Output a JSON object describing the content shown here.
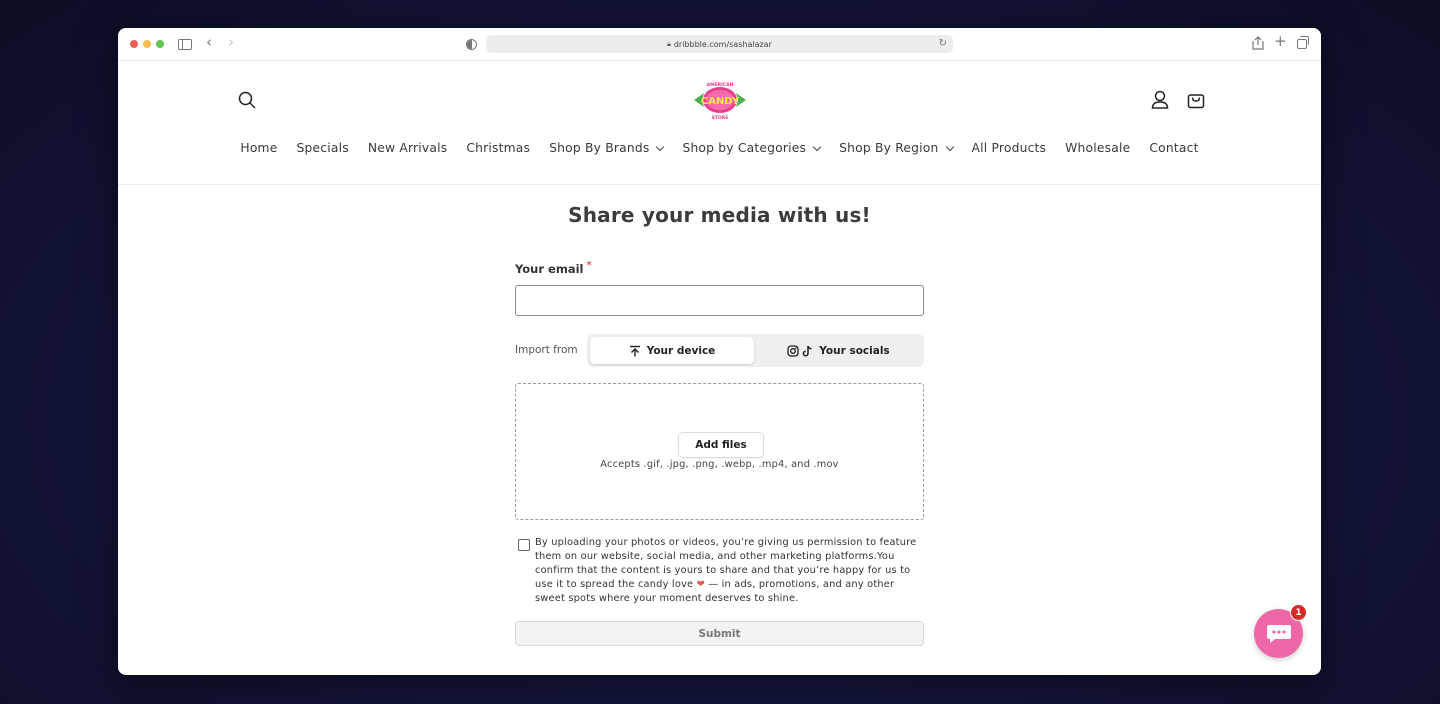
{
  "browser": {
    "url": "dribbble.com/sashalazar"
  },
  "header": {
    "logo_lines": [
      "AMERICAN",
      "CANDY",
      "STORE"
    ],
    "nav": [
      {
        "label": "Home",
        "dropdown": false
      },
      {
        "label": "Specials",
        "dropdown": false
      },
      {
        "label": "New Arrivals",
        "dropdown": false
      },
      {
        "label": "Christmas",
        "dropdown": false
      },
      {
        "label": "Shop By Brands",
        "dropdown": true
      },
      {
        "label": "Shop by Categories",
        "dropdown": true
      },
      {
        "label": "Shop By Region",
        "dropdown": true
      },
      {
        "label": "All Products",
        "dropdown": false
      },
      {
        "label": "Wholesale",
        "dropdown": false
      },
      {
        "label": "Contact",
        "dropdown": false
      }
    ]
  },
  "form": {
    "title": "Share your media with us!",
    "email_label": "Your email",
    "required_mark": "*",
    "email_value": "",
    "import_label": "Import from",
    "tab_device": "Your device",
    "tab_socials": "Your socials",
    "add_files": "Add files",
    "accepts": "Accepts .gif, .jpg, .png, .webp, .mp4, and .mov",
    "consent_before_heart": "By uploading your photos or videos, you’re giving us permission to feature them on our website, social media, and other marketing platforms.You confirm that the content is yours to share and that you’re happy for us to use it to spread the candy love",
    "consent_heart": "❤",
    "consent_after_heart": " — in ads, promotions, and any other sweet spots where your moment deserves to shine.",
    "consent_checked": false,
    "submit": "Submit"
  },
  "chat": {
    "badge": "1"
  },
  "colors": {
    "accent_pink": "#ee68a8",
    "badge_red": "#d42a2a",
    "logo_pink": "#e83e8c",
    "logo_green": "#4caf50"
  }
}
